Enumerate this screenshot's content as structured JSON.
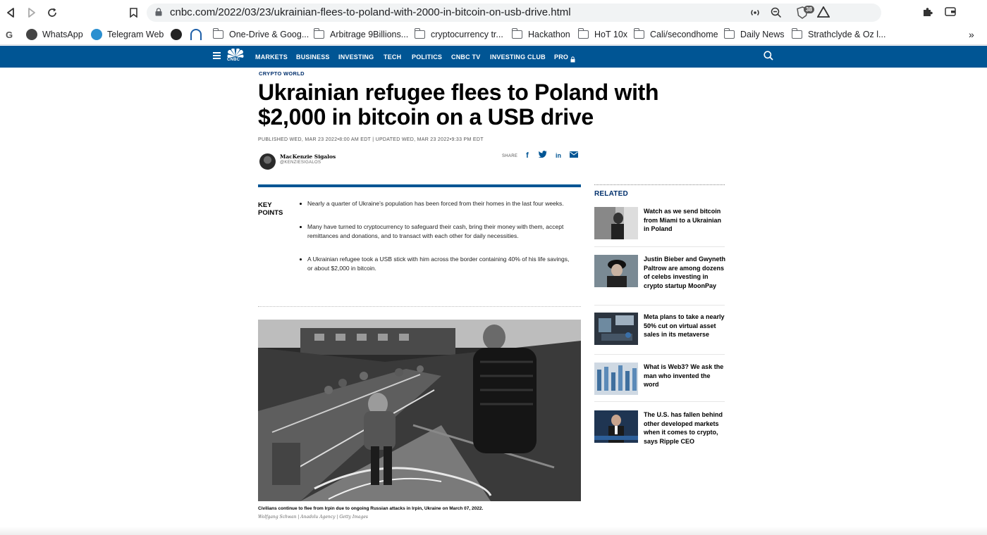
{
  "browser": {
    "url": "cnbc.com/2022/03/23/ukrainian-flees-to-poland-with-2000-in-bitcoin-on-usb-drive.html",
    "extension_badge": "38",
    "bookmarks": [
      {
        "label": "WhatsApp",
        "icon": "whatsapp-icon"
      },
      {
        "label": "Telegram Web",
        "icon": "telegram-icon"
      },
      {
        "label": "",
        "icon": "ftx-icon"
      },
      {
        "label": "",
        "icon": "opera-icon"
      },
      {
        "label": "One-Drive & Goog...",
        "icon": "folder-icon"
      },
      {
        "label": "Arbitrage 9Billions...",
        "icon": "folder-icon"
      },
      {
        "label": "cryptocurrency tr...",
        "icon": "folder-icon"
      },
      {
        "label": "Hackathon",
        "icon": "folder-icon"
      },
      {
        "label": "HoT 10x",
        "icon": "folder-icon"
      },
      {
        "label": "Cali/secondhome",
        "icon": "folder-icon"
      },
      {
        "label": "Daily News",
        "icon": "folder-icon"
      },
      {
        "label": "Strathclyde & Oz l...",
        "icon": "folder-icon"
      }
    ],
    "more": "»"
  },
  "cnbc_nav": {
    "logo": "CNBC",
    "items": [
      "MARKETS",
      "BUSINESS",
      "INVESTING",
      "TECH",
      "POLITICS",
      "CNBC TV",
      "INVESTING CLUB",
      "PRO"
    ]
  },
  "article": {
    "eyebrow": "CRYPTO WORLD",
    "headline": "Ukrainian refugee flees to Poland with $2,000 in bitcoin on a USB drive",
    "pubdate": "PUBLISHED WED, MAR 23 2022•8:00 AM EDT | UPDATED WED, MAR 23 2022•9:33 PM EDT",
    "author_name": "MacKenzie Sigalos",
    "author_handle": "@KENZIESIGALOS",
    "share_label": "SHARE",
    "key_points_title": "KEY POINTS",
    "key_points": [
      "Nearly a quarter of Ukraine’s population has been forced from their homes in the last four weeks.",
      "Many have turned to cryptocurrency to safeguard their cash, bring their money with them, accept remittances and donations, and to transact with each other for daily necessities.",
      "A Ukrainian refugee took a USB stick with him across the border containing 40% of his life savings, or about $2,000 in bitcoin."
    ],
    "caption": "Civilians continue to flee from Irpin due to ongoing Russian attacks in Irpin, Ukraine on March 07, 2022.",
    "credit": "Wolfgang Schwan | Anadolu Agency | Getty Images"
  },
  "related": {
    "title": "RELATED",
    "items": [
      "Watch as we send bitcoin from Miami to a Ukrainian in Poland",
      "Justin Bieber and Gwyneth Paltrow are among dozens of celebs investing in crypto startup MoonPay",
      "Meta plans to take a nearly 50% cut on virtual asset sales in its metaverse",
      "What is Web3? We ask the man who invented the word",
      "The U.S. has fallen behind other developed markets when it comes to crypto, says Ripple CEO"
    ]
  }
}
